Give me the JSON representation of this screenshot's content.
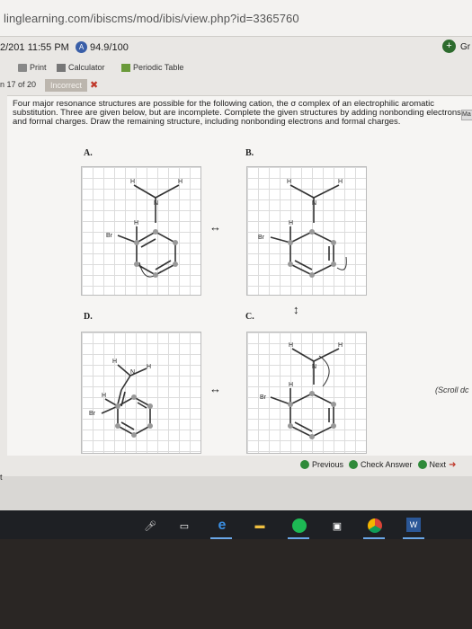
{
  "browser": {
    "url": "linglearning.com/ibiscms/mod/ibis/view.php?id=3365760"
  },
  "status": {
    "datetime": "2/201  11:55 PM",
    "score": "94.9/100",
    "grade_label": "Gr"
  },
  "toolbar": {
    "print": "Print",
    "calculator": "Calculator",
    "periodic_table": "Periodic Table"
  },
  "question_nav": {
    "position": "n 17 of 20",
    "result_badge": "Incorrect"
  },
  "question": {
    "text": "Four major resonance structures are possible for the following cation, the σ complex of an electrophilic aromatic substitution. Three are given below, but are incomplete. Complete the given structures by adding nonbonding electrons and formal charges. Draw the remaining structure, including nonbonding electrons and formal charges.",
    "side_button": "Ma"
  },
  "structures": {
    "A": {
      "label": "A.",
      "atom_h1": "H",
      "atom_n": "N",
      "atom_h2": "H",
      "atom_h3": "H",
      "atom_br": "Br",
      "charge": "+"
    },
    "B": {
      "label": "B.",
      "atom_h1": "H",
      "atom_n": "N",
      "atom_h2": "H",
      "atom_h3": "H",
      "atom_br": "Br"
    },
    "C": {
      "label": "C.",
      "atom_h1": "H",
      "atom_n": "N",
      "atom_h2": "H",
      "atom_h3": "H",
      "atom_br": "Br"
    },
    "D": {
      "label": "D.",
      "atom_h1": "H",
      "atom_n": "N",
      "atom_h2": "H",
      "atom_h3": "H",
      "atom_br": "Br"
    }
  },
  "arrows": {
    "ab": "↔",
    "cd": "↔",
    "bc": "↕"
  },
  "scroll_hint": "(Scroll dc",
  "nav": {
    "previous": "Previous",
    "check": "Check Answer",
    "next": "Next"
  },
  "lower_text": "t",
  "colors": {
    "accent_green": "#2f8a3a",
    "incorrect_red": "#c0392b",
    "grid_line": "#dcdcdc",
    "taskbar": "#1e2024"
  }
}
